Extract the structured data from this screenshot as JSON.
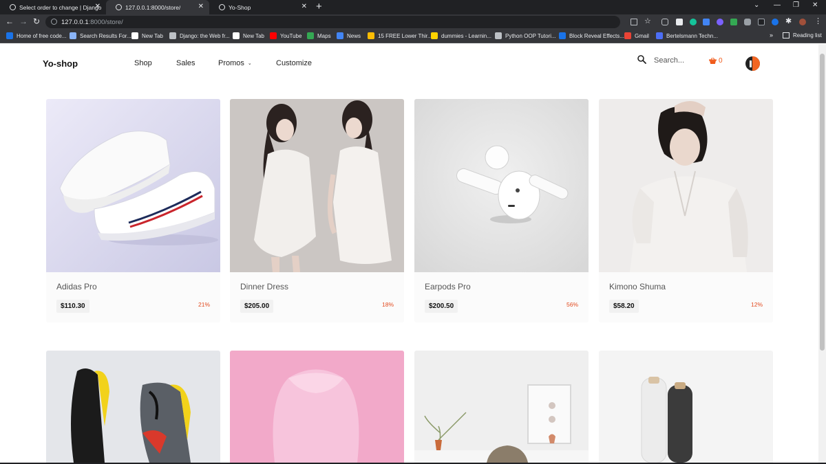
{
  "browser": {
    "tabs": [
      {
        "title": "Select order to change | Django"
      },
      {
        "title": "127.0.0.1:8000/store/"
      },
      {
        "title": "Yo-Shop"
      }
    ],
    "new_tab_symbol": "+",
    "close_symbol": "✕",
    "window_controls": [
      "⌄",
      "—",
      "❐",
      "✕"
    ],
    "nav": {
      "back": "←",
      "forward": "→",
      "reload": "↻"
    },
    "address": {
      "host": "127.0.0.1",
      "path": ":8000/store/"
    },
    "bookmarks": [
      {
        "label": "Home of free code...",
        "color": "#1a73e8"
      },
      {
        "label": "Search Results For...",
        "color": "#8ab4f8"
      },
      {
        "label": "New Tab",
        "color": "#ffffff"
      },
      {
        "label": "Django: the Web fr...",
        "color": "#bdc1c6"
      },
      {
        "label": "New Tab",
        "color": "#ffffff"
      },
      {
        "label": "YouTube",
        "color": "#ff0000"
      },
      {
        "label": "Maps",
        "color": "#34a853"
      },
      {
        "label": "News",
        "color": "#4285f4"
      },
      {
        "label": "15 FREE Lower Thir...",
        "color": "#fbbc04"
      },
      {
        "label": "dummies - Learnin...",
        "color": "#ffd400"
      },
      {
        "label": "Python OOP Tutori...",
        "color": "#bdc1c6"
      },
      {
        "label": "Block Reveal Effects...",
        "color": "#1a73e8"
      },
      {
        "label": "Gmail",
        "color": "#ea4335"
      },
      {
        "label": "Bertelsmann Techn...",
        "color": "#4c6ef5"
      }
    ],
    "bookmarks_overflow": "»",
    "reading_list": "Reading list"
  },
  "site": {
    "brand": "Yo-shop",
    "nav": {
      "shop": "Shop",
      "sales": "Sales",
      "promos": "Promos",
      "promos_chevron": "⌄",
      "customize": "Customize"
    },
    "search_placeholder": "Search...",
    "cart_count": "0",
    "accent": "#f05a1a"
  },
  "products": [
    {
      "name": "Adidas Pro",
      "price": "$110.30",
      "discount": "21%"
    },
    {
      "name": "Dinner Dress",
      "price": "$205.00",
      "discount": "18%"
    },
    {
      "name": "Earpods Pro",
      "price": "$200.50",
      "discount": "56%"
    },
    {
      "name": "Kimono Shuma",
      "price": "$58.20",
      "discount": "12%"
    }
  ]
}
